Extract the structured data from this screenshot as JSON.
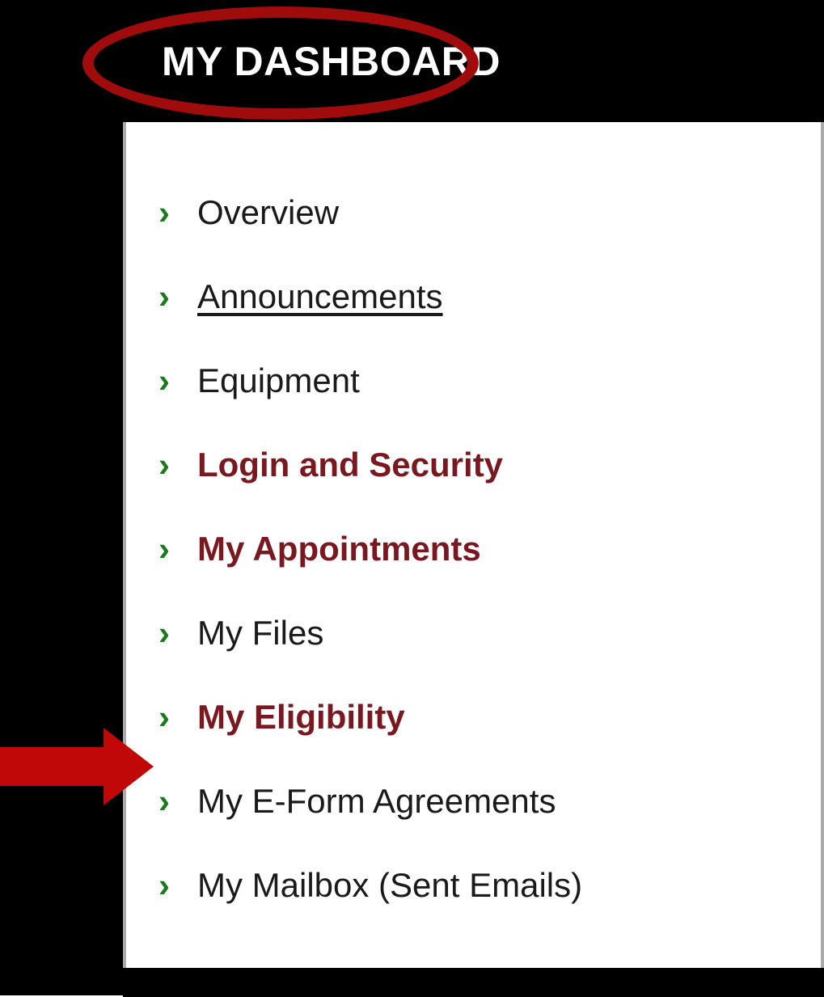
{
  "header": {
    "title": "MY DASHBOARD"
  },
  "nav": {
    "items": [
      {
        "label": "Overview",
        "style": "plain"
      },
      {
        "label": "Announcements",
        "style": "underline"
      },
      {
        "label": "Equipment",
        "style": "plain"
      },
      {
        "label": "Login and Security",
        "style": "maroon"
      },
      {
        "label": "My Appointments",
        "style": "maroon"
      },
      {
        "label": "My Files",
        "style": "plain"
      },
      {
        "label": "My Eligibility",
        "style": "maroon"
      },
      {
        "label": "My E-Form Agreements",
        "style": "plain"
      },
      {
        "label": "My Mailbox (Sent Emails)",
        "style": "plain"
      }
    ]
  }
}
